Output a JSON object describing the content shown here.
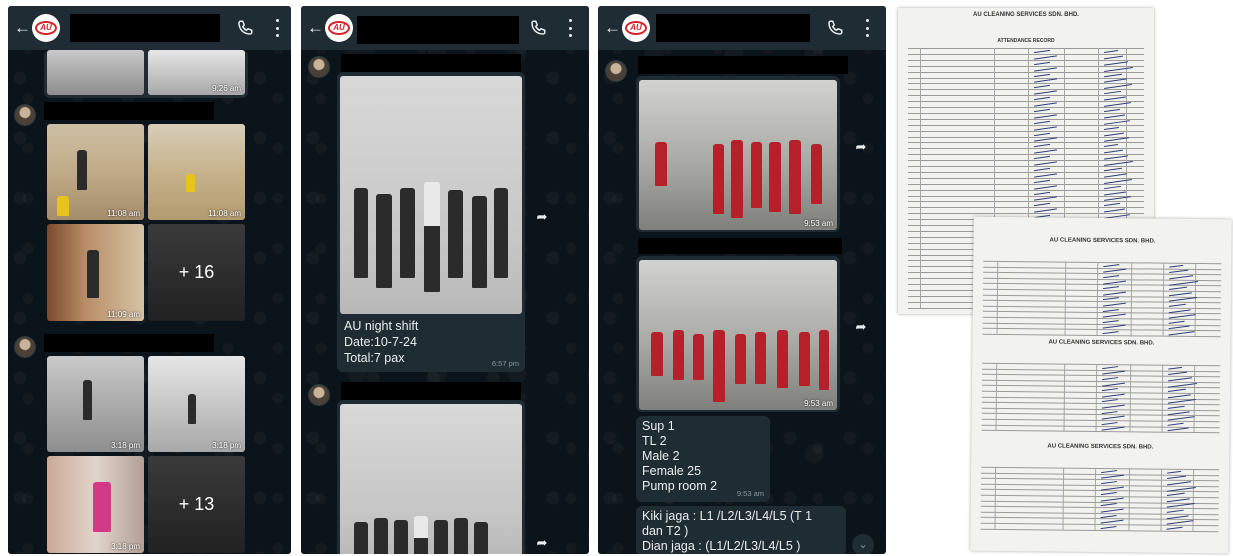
{
  "panel1": {
    "timestamps": [
      "9:26 am",
      "11:08 am",
      "11:08 am",
      "11:09 am",
      "3:18 pm",
      "3:18 pm",
      "3:18 pm"
    ],
    "more_counts": [
      "+ 16",
      "+ 13"
    ]
  },
  "panel2": {
    "message_lines": [
      "AU night shift",
      "Date:10-7-24",
      "Total:7 pax"
    ],
    "message_time": "6:57 pm"
  },
  "panel3": {
    "photo_times": [
      "9:53 am",
      "9:53 am"
    ],
    "summary_lines": [
      "Sup 1",
      "TL 2",
      "Male 2",
      "Female 25",
      "Pump room 2"
    ],
    "summary_time": "9:53 am",
    "guard_lines": [
      "Kiki jaga : L1 /L2/L3/L4/L5 (T 1",
      "dan T2 )",
      "Dian jaga : (L1/L2/L3/L4/L5 )"
    ]
  },
  "documents": {
    "titles": [
      "AU CLEANING SERVICES SDN. BHD.",
      "AU CLEANING SERVICES SDN. BHD.",
      "AU CLEANING SERVICES SDN. BHD.",
      "AU CLEANING SERVICES SDN. BHD."
    ],
    "sheet_heading": "ATTENDANCE RECORD"
  },
  "colors": {
    "chat_bg": "#0b141a",
    "header": "#1f2c34",
    "bubble": "#202c33",
    "brand_red": "#d2232a"
  }
}
